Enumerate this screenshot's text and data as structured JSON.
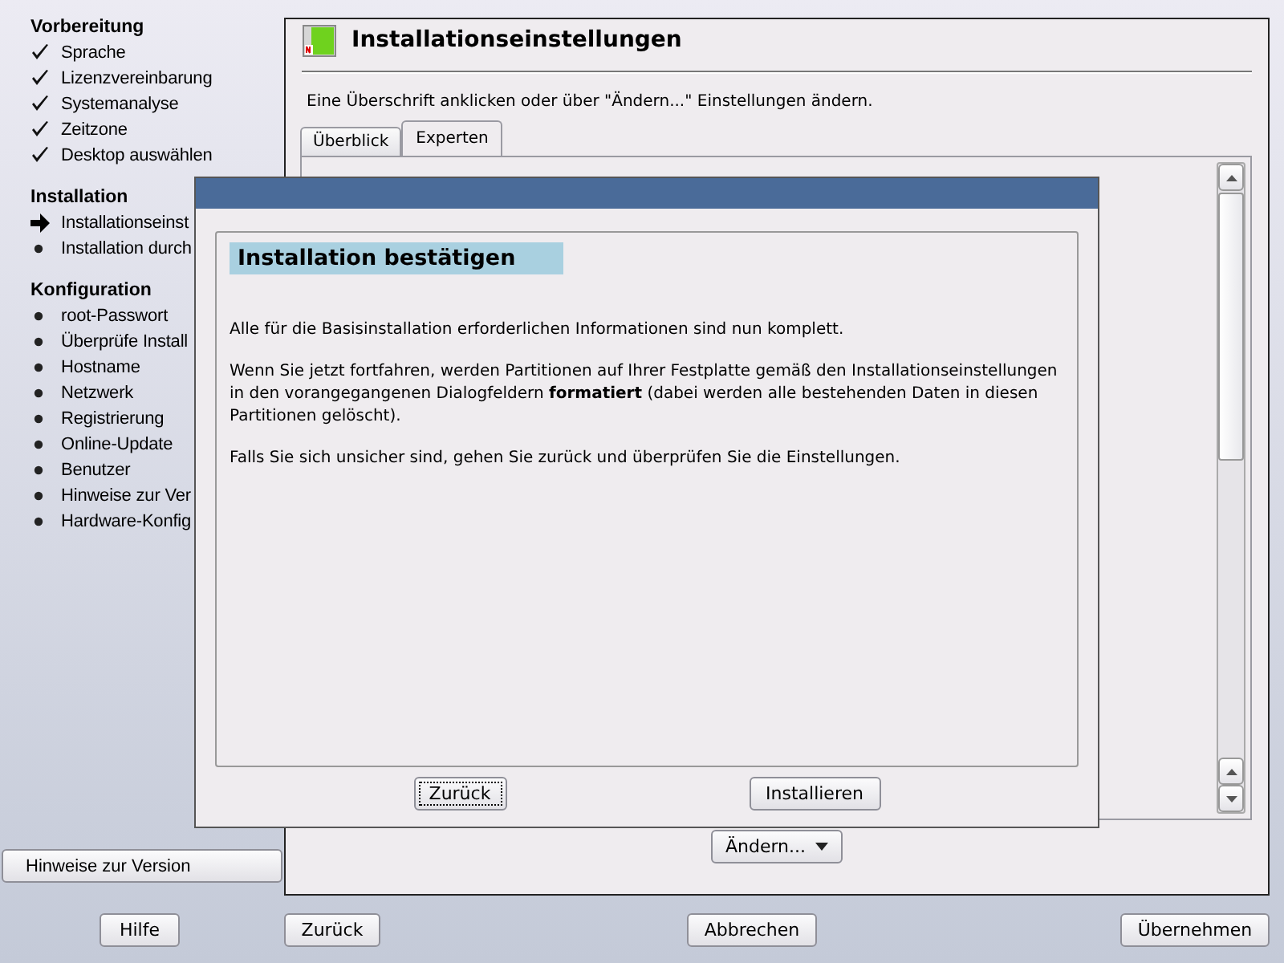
{
  "sidebar": {
    "sections": [
      {
        "heading": "Vorbereitung",
        "items": [
          {
            "label": "Sprache",
            "kind": "done"
          },
          {
            "label": "Lizenzvereinbarung",
            "kind": "done"
          },
          {
            "label": "Systemanalyse",
            "kind": "done"
          },
          {
            "label": "Zeitzone",
            "kind": "done"
          },
          {
            "label": "Desktop auswählen",
            "kind": "done"
          }
        ]
      },
      {
        "heading": "Installation",
        "items": [
          {
            "label": "Installationseinst",
            "kind": "current"
          },
          {
            "label": "Installation durch",
            "kind": "todo"
          }
        ]
      },
      {
        "heading": "Konfiguration",
        "items": [
          {
            "label": "root-Passwort",
            "kind": "todo"
          },
          {
            "label": "Überprüfe Install",
            "kind": "todo"
          },
          {
            "label": "Hostname",
            "kind": "todo"
          },
          {
            "label": "Netzwerk",
            "kind": "todo"
          },
          {
            "label": "Registrierung",
            "kind": "todo"
          },
          {
            "label": "Online-Update",
            "kind": "todo"
          },
          {
            "label": "Benutzer",
            "kind": "todo"
          },
          {
            "label": "Hinweise zur Ver",
            "kind": "todo"
          },
          {
            "label": "Hardware-Konfig",
            "kind": "todo"
          }
        ]
      }
    ],
    "release_notes_button": "Hinweise zur Version"
  },
  "panel": {
    "title": "Installationseinstellungen",
    "hint": "Eine Überschrift anklicken oder über \"Ändern...\" Einstellungen ändern.",
    "tabs": [
      {
        "label": "Überblick",
        "selected": false
      },
      {
        "label": "Experten",
        "selected": true
      }
    ],
    "change_button": "Ändern..."
  },
  "dialog": {
    "heading": "Installation bestätigen",
    "paragraphs": [
      "Alle für die Basisinstallation erforderlichen Informationen sind nun komplett.",
      "Wenn Sie jetzt fortfahren, werden Partitionen auf Ihrer Festplatte gemäß den Installationseinstellungen in den vorangegangenen Dialogfeldern **formatiert** (dabei werden alle bestehenden Daten in diesen Partitionen gelöscht).",
      "Falls Sie sich unsicher sind, gehen Sie zurück und überprüfen Sie die Einstellungen."
    ],
    "buttons": [
      {
        "label": "Zurück",
        "focused": true
      },
      {
        "label": "Installieren",
        "focused": false
      }
    ]
  },
  "bottom_buttons": [
    "Hilfe",
    "Zurück",
    "Abbrechen",
    "Übernehmen"
  ]
}
